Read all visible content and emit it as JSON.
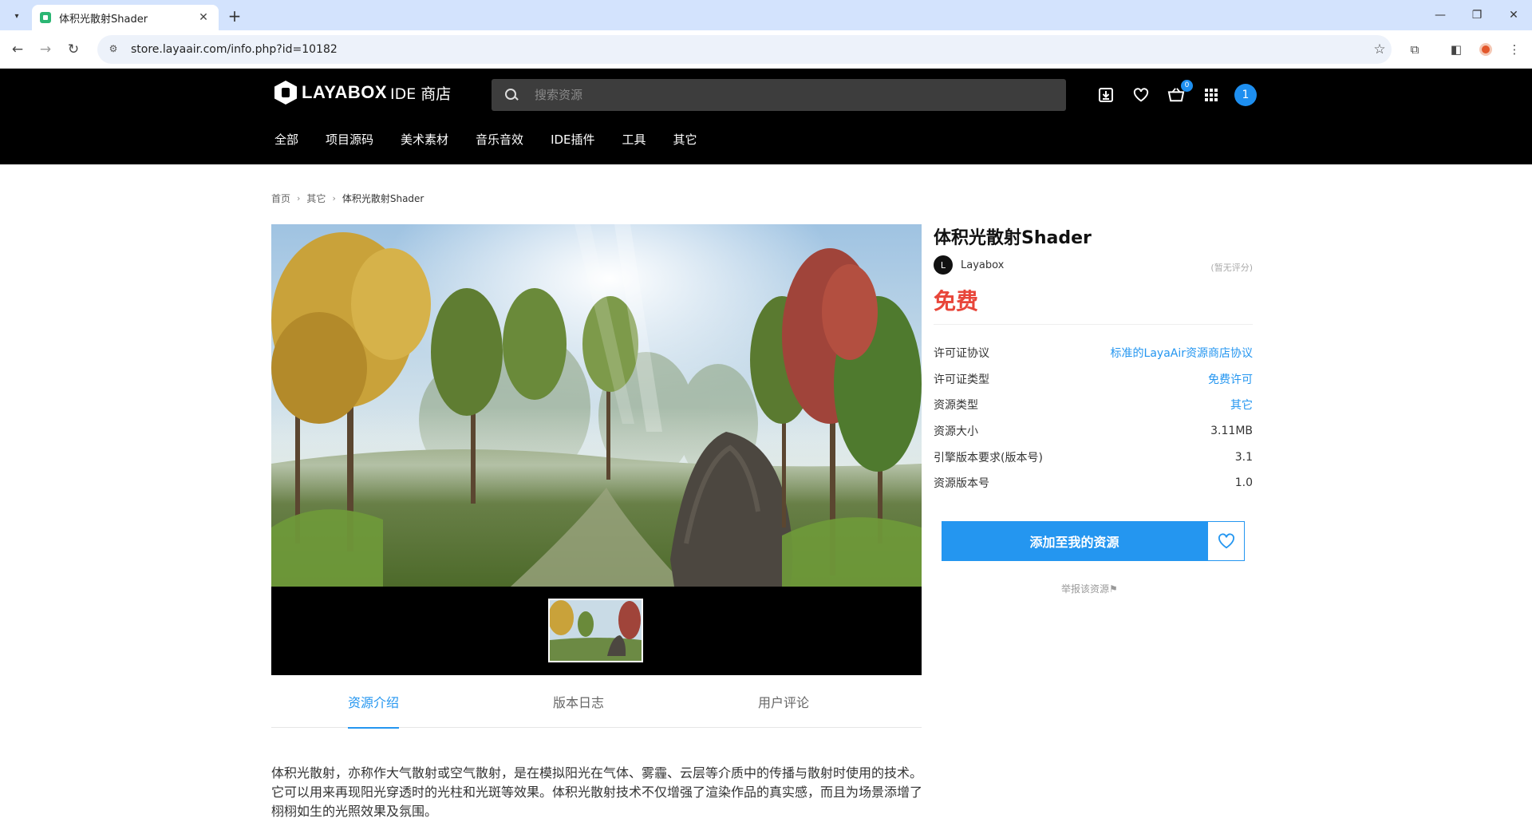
{
  "browser": {
    "tab_title": "体积光散射Shader",
    "url": "store.layaair.com/info.php?id=10182",
    "icons": [
      "tab-list-icon",
      "close-icon",
      "plus-icon",
      "minimize-icon",
      "restore-icon",
      "window-close-icon",
      "back-icon",
      "forward-icon",
      "reload-icon",
      "site-settings-icon",
      "bookmark-star-icon",
      "extensions-icon",
      "side-panel-icon",
      "profile-icon",
      "more-menu-icon"
    ]
  },
  "header": {
    "logo_text": "LAYABOX",
    "logo_sub": "IDE 商店",
    "search_placeholder": "搜索资源",
    "cart_count": "0",
    "user_initial": "1",
    "nav": [
      "全部",
      "项目源码",
      "美术素材",
      "音乐音效",
      "IDE插件",
      "工具",
      "其它"
    ]
  },
  "breadcrumb": {
    "home": "首页",
    "category": "其它",
    "current": "体积光散射Shader"
  },
  "product": {
    "title": "体积光散射Shader",
    "author_initial": "L",
    "author": "Layabox",
    "rating": "(暂无评分)",
    "price": "免费",
    "specs": [
      {
        "label": "许可证协议",
        "value": "标准的LayaAir资源商店协议",
        "link": true
      },
      {
        "label": "许可证类型",
        "value": "免费许可",
        "link": true
      },
      {
        "label": "资源类型",
        "value": "其它",
        "link": true
      },
      {
        "label": "资源大小",
        "value": "3.11MB",
        "link": false
      },
      {
        "label": "引擎版本要求(版本号)",
        "value": "3.1",
        "link": false
      },
      {
        "label": "资源版本号",
        "value": "1.0",
        "link": false
      }
    ],
    "add_button": "添加至我的资源",
    "report": "举报该资源⚑"
  },
  "tabs": [
    "资源介绍",
    "版本日志",
    "用户评论"
  ],
  "description": "体积光散射，亦称作大气散射或空气散射，是在模拟阳光在气体、雾霾、云层等介质中的传播与散射时使用的技术。它可以用来再现阳光穿透时的光柱和光斑等效果。体积光散射技术不仅增强了渲染作品的真实感，而且为场景添增了栩栩如生的光照效果及氛围。",
  "colors": {
    "accent": "#2496f0",
    "price": "#e8463a",
    "header_bg": "#000000",
    "tabbar_bg": "#d3e3fd"
  }
}
